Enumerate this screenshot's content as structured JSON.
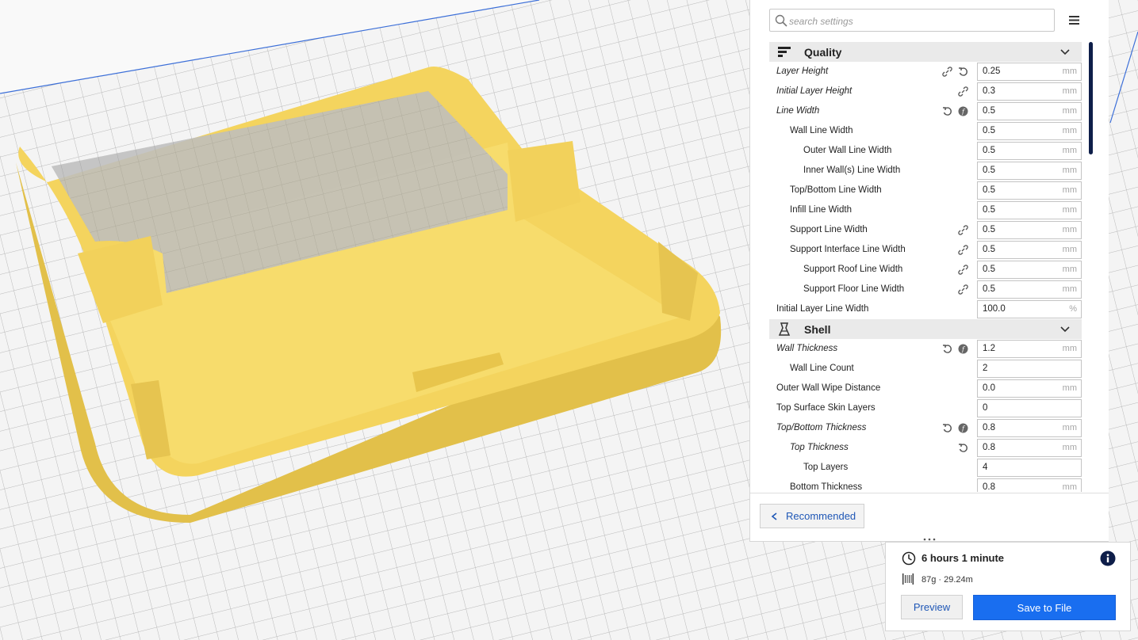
{
  "search": {
    "placeholder": "search settings"
  },
  "categories": [
    {
      "label": "Quality",
      "icon": "quality-icon"
    },
    {
      "label": "Shell",
      "icon": "shell-icon"
    }
  ],
  "quality": [
    {
      "label": "Layer Height",
      "value": "0.25",
      "unit": "mm"
    },
    {
      "label": "Initial Layer Height",
      "value": "0.3",
      "unit": "mm"
    },
    {
      "label": "Line Width",
      "value": "0.5",
      "unit": "mm"
    },
    {
      "label": "Wall Line Width",
      "value": "0.5",
      "unit": "mm"
    },
    {
      "label": "Outer Wall Line Width",
      "value": "0.5",
      "unit": "mm"
    },
    {
      "label": "Inner Wall(s) Line Width",
      "value": "0.5",
      "unit": "mm"
    },
    {
      "label": "Top/Bottom Line Width",
      "value": "0.5",
      "unit": "mm"
    },
    {
      "label": "Infill Line Width",
      "value": "0.5",
      "unit": "mm"
    },
    {
      "label": "Support Line Width",
      "value": "0.5",
      "unit": "mm"
    },
    {
      "label": "Support Interface Line Width",
      "value": "0.5",
      "unit": "mm"
    },
    {
      "label": "Support Roof Line Width",
      "value": "0.5",
      "unit": "mm"
    },
    {
      "label": "Support Floor Line Width",
      "value": "0.5",
      "unit": "mm"
    },
    {
      "label": "Initial Layer Line Width",
      "value": "100.0",
      "unit": "%"
    }
  ],
  "shell": [
    {
      "label": "Wall Thickness",
      "value": "1.2",
      "unit": "mm"
    },
    {
      "label": "Wall Line Count",
      "value": "2",
      "unit": ""
    },
    {
      "label": "Outer Wall Wipe Distance",
      "value": "0.0",
      "unit": "mm"
    },
    {
      "label": "Top Surface Skin Layers",
      "value": "0",
      "unit": ""
    },
    {
      "label": "Top/Bottom Thickness",
      "value": "0.8",
      "unit": "mm"
    },
    {
      "label": "Top Thickness",
      "value": "0.8",
      "unit": "mm"
    },
    {
      "label": "Top Layers",
      "value": "4",
      "unit": ""
    },
    {
      "label": "Bottom Thickness",
      "value": "0.8",
      "unit": "mm"
    }
  ],
  "footer": {
    "recommended_label": "Recommended"
  },
  "print": {
    "time": "6 hours 1 minute",
    "material": "87g · 29.24m",
    "preview_label": "Preview",
    "save_label": "Save to File"
  },
  "colors": {
    "accent": "#196ef0",
    "model": "#f5d862",
    "scrollbar": "#0e1e49"
  }
}
